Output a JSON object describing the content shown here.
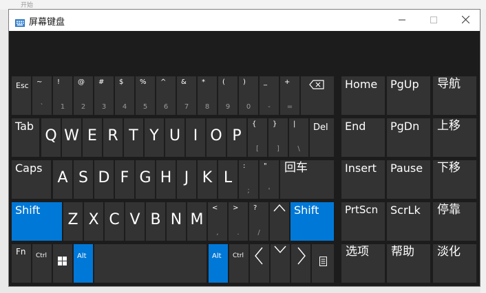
{
  "background": {
    "fragment": "开始"
  },
  "window": {
    "title": "屏幕键盘"
  },
  "keys": {
    "esc": "Esc",
    "tab": "Tab",
    "caps": "Caps",
    "shift": "Shift",
    "fn": "Fn",
    "ctrl": "Ctrl",
    "alt": "Alt",
    "del": "Del",
    "enter": "回车",
    "row1": [
      {
        "upper": "~",
        "lower": "`"
      },
      {
        "upper": "!",
        "lower": "1"
      },
      {
        "upper": "@",
        "lower": "2"
      },
      {
        "upper": "#",
        "lower": "3"
      },
      {
        "upper": "$",
        "lower": "4"
      },
      {
        "upper": "%",
        "lower": "5"
      },
      {
        "upper": "^",
        "lower": "6"
      },
      {
        "upper": "&",
        "lower": "7"
      },
      {
        "upper": "*",
        "lower": "8"
      },
      {
        "upper": "(",
        "lower": "9"
      },
      {
        "upper": ")",
        "lower": "0"
      },
      {
        "upper": "_",
        "lower": "-"
      },
      {
        "upper": "+",
        "lower": "="
      }
    ],
    "row2_letters": [
      "Q",
      "W",
      "E",
      "R",
      "T",
      "Y",
      "U",
      "I",
      "O",
      "P"
    ],
    "row2_sym": [
      {
        "upper": "{",
        "lower": "["
      },
      {
        "upper": "}",
        "lower": "]"
      },
      {
        "upper": "|",
        "lower": "\\"
      }
    ],
    "row3_letters": [
      "A",
      "S",
      "D",
      "F",
      "G",
      "H",
      "J",
      "K",
      "L"
    ],
    "row3_sym": [
      {
        "upper": ":",
        "lower": ";"
      },
      {
        "upper": "\"",
        "lower": "'"
      }
    ],
    "row4_letters": [
      "Z",
      "X",
      "C",
      "V",
      "B",
      "N",
      "M"
    ],
    "row4_sym": [
      {
        "upper": "<",
        "lower": ","
      },
      {
        "upper": ">",
        "lower": "."
      },
      {
        "upper": "?",
        "lower": "/"
      }
    ],
    "nav": {
      "home": "Home",
      "pgup": "PgUp",
      "nav_pane": "导航",
      "end": "End",
      "pgdn": "PgDn",
      "move_up": "上移",
      "insert": "Insert",
      "pause": "Pause",
      "move_down": "下移",
      "prtscn": "PrtScn",
      "scrlk": "ScrLk",
      "dock": "停靠",
      "options": "选项",
      "help": "帮助",
      "fade": "淡化"
    }
  },
  "colors": {
    "active_key": "#0078d7",
    "key": "#333333",
    "panel": "#1c1c1c"
  }
}
